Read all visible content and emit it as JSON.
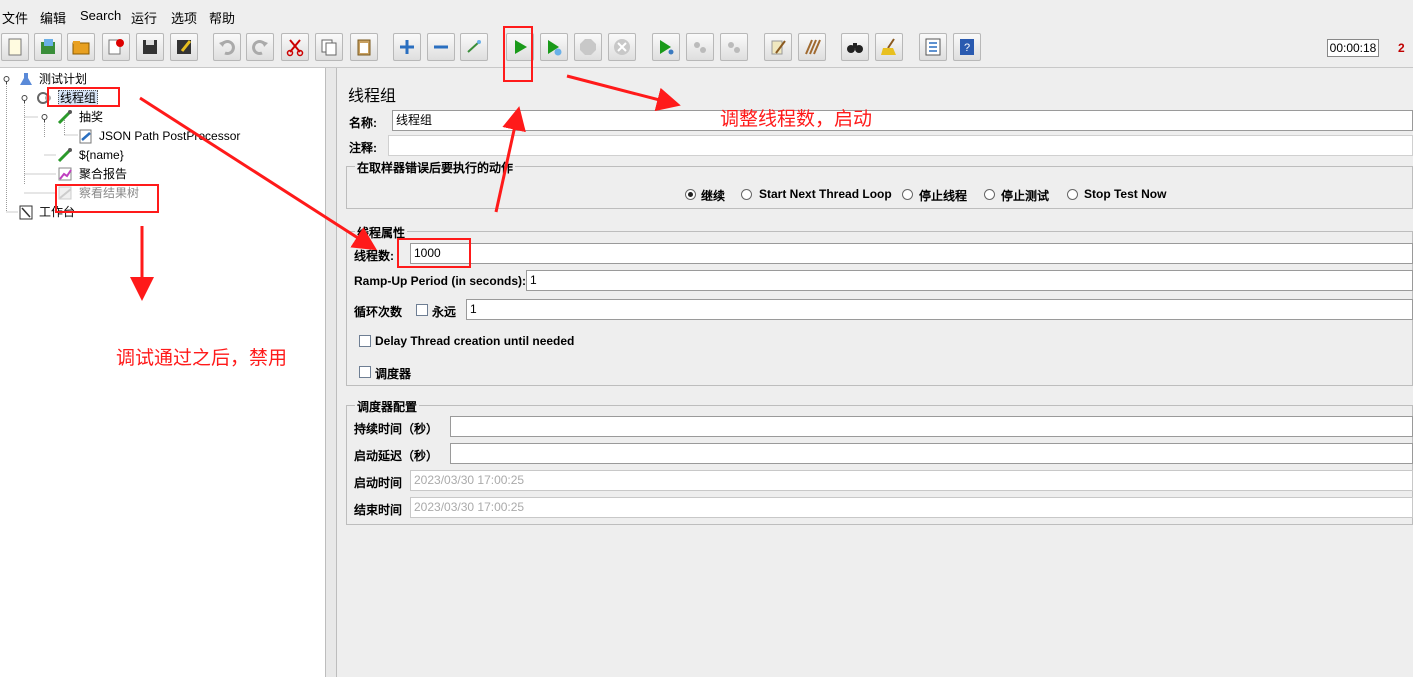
{
  "menu": [
    "文件",
    "编辑",
    "Search",
    "运行",
    "选项",
    "帮助"
  ],
  "toolbar": {
    "buttons": [
      "new",
      "templates",
      "open",
      "close",
      "save",
      "save-as",
      "undo",
      "redo",
      "cut",
      "copy",
      "paste",
      "expand",
      "collapse",
      "toggle",
      "start",
      "start-no-pauses",
      "stop",
      "shutdown",
      "remote-start",
      "remote-stop",
      "remote-shutdown",
      "clear",
      "clear-all",
      "search",
      "reset-search",
      "function-helper",
      "help"
    ],
    "timer": "00:00:18",
    "error_count": "2"
  },
  "tree": {
    "items": [
      {
        "label": "测试计划",
        "icon": "test-plan-icon"
      },
      {
        "label": "线程组",
        "icon": "thread-group-icon",
        "selected": true
      },
      {
        "label": "抽奖",
        "icon": "sampler-icon"
      },
      {
        "label": "JSON Path PostProcessor",
        "icon": "post-processor-icon"
      },
      {
        "label": "${name}",
        "icon": "sampler-icon"
      },
      {
        "label": "聚合报告",
        "icon": "report-icon"
      },
      {
        "label": "察看结果树",
        "icon": "listener-icon",
        "disabled": true
      },
      {
        "label": "工作台",
        "icon": "workbench-icon"
      }
    ]
  },
  "editor": {
    "title": "线程组",
    "name_label": "名称:",
    "name_value": "线程组",
    "comment_label": "注释:",
    "comment_value": "",
    "error_action": {
      "title": "在取样器错误后要执行的动作",
      "options": [
        "继续",
        "Start Next Thread Loop",
        "停止线程",
        "停止测试",
        "Stop Test Now"
      ],
      "selected": "继续"
    },
    "thread_props": {
      "title": "线程属性",
      "threads_label": "线程数:",
      "threads_value": "1000",
      "rampup_label": "Ramp-Up Period (in seconds):",
      "rampup_value": "1",
      "loop_label": "循环次数",
      "forever_label": "永远",
      "forever_checked": false,
      "loop_value": "1",
      "delay_label": "Delay Thread creation until needed",
      "delay_checked": false,
      "scheduler_label": "调度器",
      "scheduler_checked": false
    },
    "scheduler_config": {
      "title": "调度器配置",
      "duration_label": "持续时间（秒）",
      "duration_value": "",
      "delay_label": "启动延迟（秒）",
      "delay_value": "",
      "start_label": "启动时间",
      "start_value": "2023/03/30 17:00:25",
      "end_label": "结束时间",
      "end_value": "2023/03/30 17:00:25"
    }
  },
  "annotations": {
    "top_note": "调整线程数，启动",
    "left_note": "调试通过之后，禁用",
    "color": "#ff1a1a"
  }
}
